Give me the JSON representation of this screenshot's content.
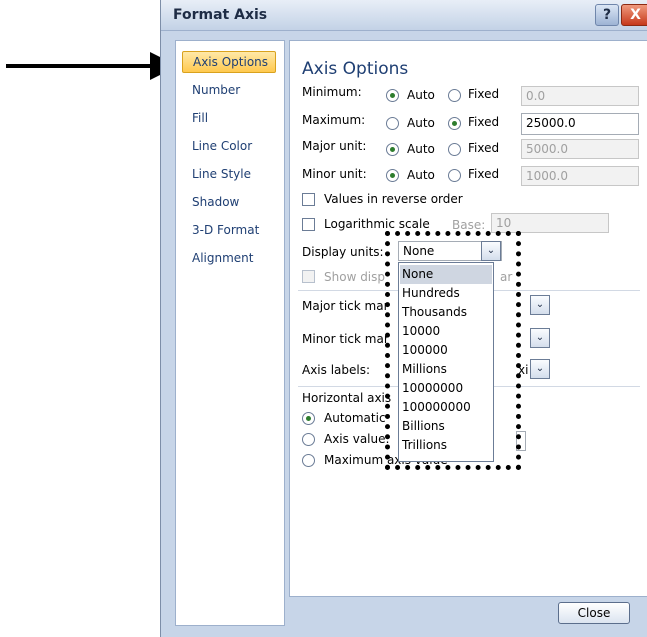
{
  "dialog": {
    "title": "Format Axis",
    "help_label": "?",
    "close_x_label": "X",
    "close_button": "Close"
  },
  "nav": {
    "items": [
      {
        "label": "Axis Options"
      },
      {
        "label": "Number"
      },
      {
        "label": "Fill"
      },
      {
        "label": "Line Color"
      },
      {
        "label": "Line Style"
      },
      {
        "label": "Shadow"
      },
      {
        "label": "3-D Format"
      },
      {
        "label": "Alignment"
      }
    ]
  },
  "content": {
    "heading": "Axis Options",
    "rows": [
      {
        "label": "Minimum:",
        "auto": "Auto",
        "fixed": "Fixed",
        "selected": "auto",
        "value": "0.0"
      },
      {
        "label": "Maximum:",
        "auto": "Auto",
        "fixed": "Fixed",
        "selected": "fixed",
        "value": "25000.0"
      },
      {
        "label": "Major unit:",
        "auto": "Auto",
        "fixed": "Fixed",
        "selected": "auto",
        "value": "5000.0"
      },
      {
        "label": "Minor unit:",
        "auto": "Auto",
        "fixed": "Fixed",
        "selected": "auto",
        "value": "1000.0"
      }
    ],
    "reverse_order": "Values in reverse order",
    "log_scale": "Logarithmic scale",
    "base_label": "Base:",
    "base_value": "10",
    "display_units_label": "Display units:",
    "display_units_value": "None",
    "show_label_partial": "Show disp",
    "show_label_end": "ar",
    "major_tick_label": "Major tick mar",
    "minor_tick_label": "Minor tick mar",
    "axis_labels_label": "Axis labels:",
    "axis_labels_partial": "xi",
    "h_axis_label": "Horizontal axis",
    "automatic": "Automatic",
    "axis_value": "Axis value:",
    "max_axis_value": "Maximum axis value"
  },
  "dropdown": {
    "options": [
      "None",
      "Hundreds",
      "Thousands",
      "10000",
      "100000",
      "Millions",
      "10000000",
      "100000000",
      "Billions",
      "Trillions"
    ],
    "selected": "None"
  }
}
